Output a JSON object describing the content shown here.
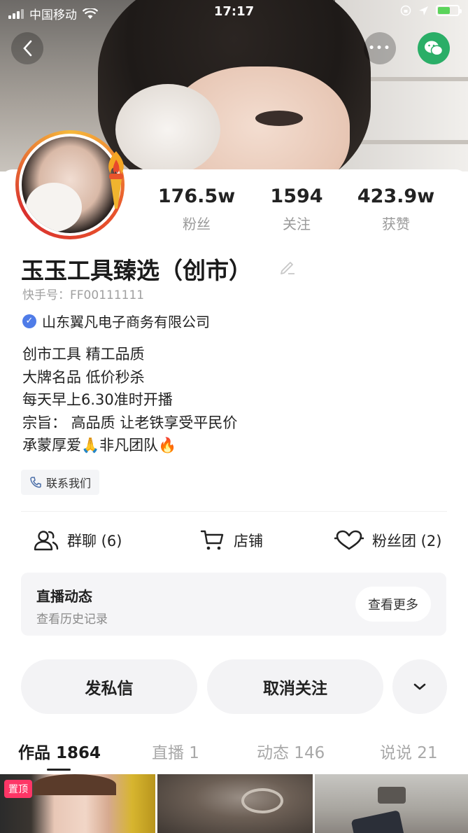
{
  "status_bar": {
    "carrier": "中国移动",
    "time": "17:17"
  },
  "header": {
    "more_label": "•••"
  },
  "profile": {
    "name": "玉玉工具臻选（创市）",
    "kwai_id": "快手号：FF00111111",
    "company": "山东翼凡电子商务有限公司",
    "bio": [
      "创市工具 精工品质",
      "大牌名品 低价秒杀",
      "每天早上6.30准时开播",
      "宗旨：  高品质  让老铁享受平民价",
      "承蒙厚爱🙏非凡团队🔥"
    ],
    "contact_label": "联系我们"
  },
  "stats": [
    {
      "value": "176.5w",
      "label": "粉丝"
    },
    {
      "value": "1594",
      "label": "关注"
    },
    {
      "value": "423.9w",
      "label": "获赞"
    }
  ],
  "actions": {
    "group_chat": "群聊 (6)",
    "shop": "店铺",
    "fan_club": "粉丝团 (2)"
  },
  "live_card": {
    "title": "直播动态",
    "subtitle": "查看历史记录",
    "more": "查看更多"
  },
  "buttons": {
    "message": "发私信",
    "unfollow": "取消关注"
  },
  "tabs": [
    {
      "label": "作品 1864",
      "active": true
    },
    {
      "label": "直播 1",
      "active": false
    },
    {
      "label": "动态 146",
      "active": false
    },
    {
      "label": "说说 21",
      "active": false
    }
  ],
  "thumbnails": {
    "pinned_label": "置顶"
  },
  "colors": {
    "accent_pink": "#fe3666",
    "wechat_green": "#2aae67",
    "verified_blue": "#4f7ce8",
    "battery_green": "#5bd45b"
  }
}
